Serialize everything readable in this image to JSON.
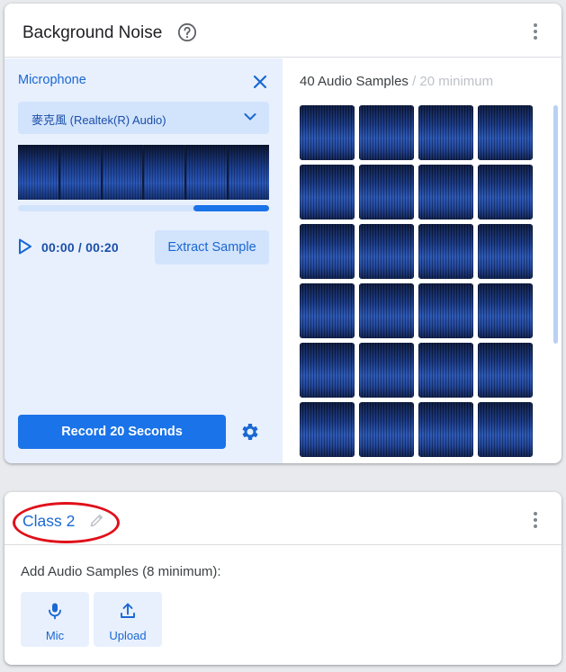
{
  "background_card": {
    "title": "Background Noise",
    "help_icon": "help-circle-icon",
    "menu_icon": "more-vert-icon",
    "microphone": {
      "label": "Microphone",
      "close_icon": "close-icon",
      "device_selected": "麥克風 (Realtek(R) Audio)",
      "dropdown_icon": "chevron-down-icon",
      "waveform_segments": 6,
      "time_current": "00:00",
      "time_separator": "/",
      "time_total": "00:20",
      "progress_fraction": 0.3,
      "play_icon": "play-icon",
      "extract_label": "Extract Sample",
      "record_label": "Record 20 Seconds",
      "settings_icon": "gear-icon"
    },
    "samples": {
      "count_label": "40 Audio Samples",
      "minimum_label": "/ 20 minimum",
      "visible_thumbnails": 24
    }
  },
  "class_card": {
    "title": "Class 2",
    "edit_icon": "pencil-icon",
    "menu_icon": "more-vert-icon",
    "add_label": "Add Audio Samples (8 minimum):",
    "buttons": [
      {
        "label": "Mic",
        "icon": "mic-icon"
      },
      {
        "label": "Upload",
        "icon": "upload-icon"
      }
    ]
  },
  "colors": {
    "accent": "#1a73e8",
    "panel_bg": "#e8f0fe",
    "annotation": "#e0101a"
  }
}
